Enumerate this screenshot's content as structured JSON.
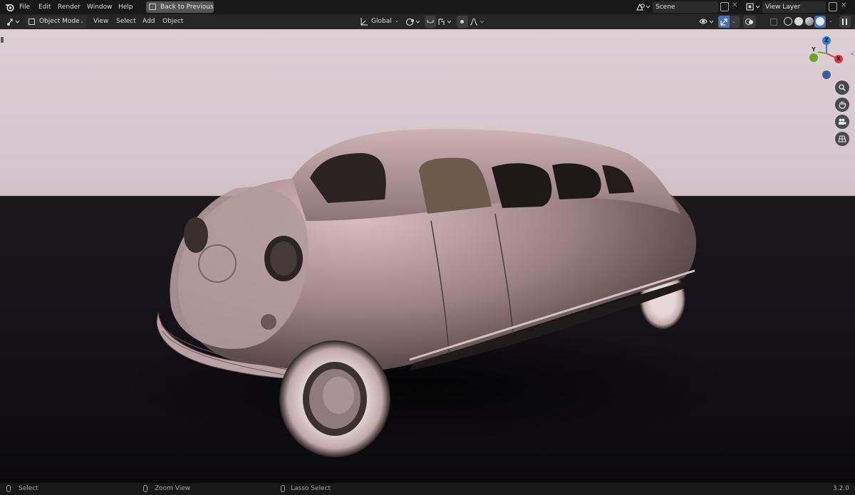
{
  "menu": {
    "items": [
      "File",
      "Edit",
      "Render",
      "Window",
      "Help"
    ],
    "back_button": "Back to Previous"
  },
  "scene": {
    "name": "Scene"
  },
  "view_layer": {
    "name": "View Layer"
  },
  "viewport_header": {
    "mode": "Object Mode",
    "menus": [
      "View",
      "Select",
      "Add",
      "Object"
    ],
    "transform_orientation": "Global"
  },
  "gizmo": {
    "z": "Z",
    "y": "Y",
    "x": "X"
  },
  "statusbar": {
    "select": "Select",
    "zoom": "Zoom View",
    "lasso": "Lasso Select",
    "version": "3.2.0"
  },
  "colors": {
    "accent": "#4772b3",
    "axis_x": "#e1394a",
    "axis_y": "#6ea51f",
    "axis_z": "#2f7fd6"
  }
}
